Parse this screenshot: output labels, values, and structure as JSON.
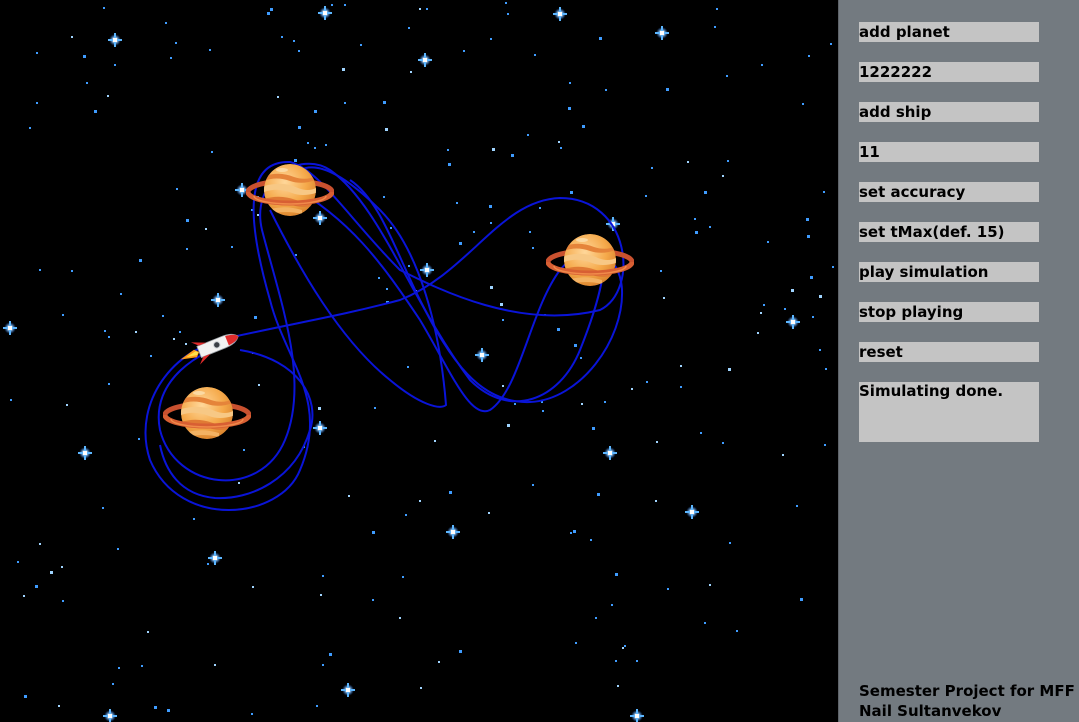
{
  "panel": {
    "add_planet_label": "add planet",
    "planet_input_value": "1222222",
    "add_ship_label": "add ship",
    "ship_input_value": "11",
    "set_accuracy_label": "set accuracy",
    "set_tmax_label": "set tMax(def. 15)",
    "play_label": "play simulation",
    "stop_label": "stop playing",
    "reset_label": "reset",
    "status_text": "Simulating done.",
    "credits_line1": "Semester Project for MFF",
    "credits_line2": "Nail Sultanvekov"
  },
  "space": {
    "planets_count": 3,
    "ships_count": 1,
    "icons": [
      "planet-icon",
      "rocket-icon",
      "star-icon"
    ]
  },
  "colors": {
    "space_background": "#000000",
    "panel_background": "#737a80",
    "control_background": "#c4c4c4",
    "trajectory": "#0a14d8",
    "star": "#49aaff"
  }
}
